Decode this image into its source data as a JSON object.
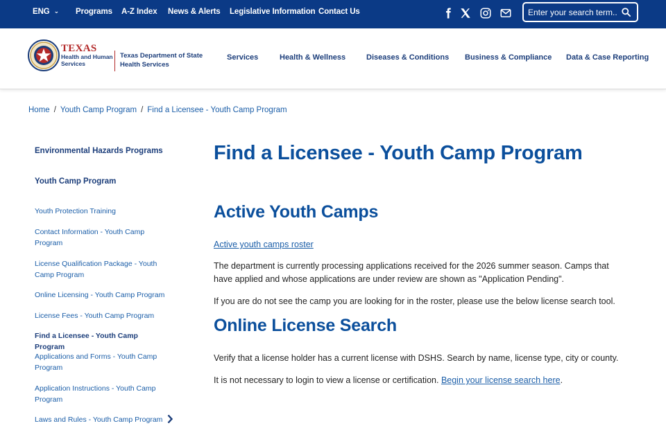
{
  "topbar": {
    "language": "ENG",
    "links": [
      "Programs",
      "A-Z Index",
      "News & Alerts",
      "Legislative Information",
      "Contact Us"
    ],
    "social_icons": [
      "facebook-icon",
      "x-twitter-icon",
      "instagram-icon",
      "email-icon"
    ],
    "search_placeholder": "Enter your search term..",
    "bg_color": "#0b3a86"
  },
  "header": {
    "logo": {
      "line1": "TEXAS",
      "line2": "Health and Human",
      "line3": "Services"
    },
    "agency_name_line1": "Texas Department of State",
    "agency_name_line2": "Health Services",
    "nav": [
      "Services",
      "Health & Wellness",
      "Diseases & Conditions",
      "Business & Compliance",
      "Data & Case Reporting"
    ]
  },
  "breadcrumb": {
    "items": [
      "Home",
      "Youth Camp Program",
      "Find a Licensee - Youth Camp Program"
    ],
    "separator": "/"
  },
  "sidebar": {
    "headings": [
      "Environmental Hazards Programs",
      "Youth Camp Program"
    ],
    "links": [
      "Youth Protection Training",
      "Contact Information - Youth Camp Program",
      "License Qualification Package - Youth Camp Program",
      "Online Licensing - Youth Camp Program",
      "License Fees - Youth Camp Program",
      "Find a Licensee - Youth Camp Program",
      "Applications and Forms - Youth Camp Program",
      "Application Instructions - Youth Camp Program",
      "Laws and Rules - Youth Camp Program"
    ],
    "active_index": 5
  },
  "main": {
    "title": "Find a Licensee - Youth Camp Program",
    "section1": {
      "heading": "Active Youth Camps",
      "roster_link": "Active youth camps roster",
      "para1": "The department is currently processing applications received for the 2026 summer season.  Camps that have applied and whose applications are under review are shown as \"Application Pending\".",
      "para2": "If you are do not see the camp you are looking for in the roster, please use the below license search tool."
    },
    "section2": {
      "heading": "Online License Search",
      "para1": "Verify that a license holder has a current license with DSHS. Search by name, license type, city or county.",
      "para2_text": "It is not necessary to login to view a license or certification. ",
      "para2_link": "Begin your license search here",
      "para2_end": "."
    }
  },
  "colors": {
    "heading_blue": "#0b4f9c",
    "link_blue": "#1b5ea8",
    "nav_navy": "#1b3d7a",
    "logo_red": "#b32a2a"
  }
}
